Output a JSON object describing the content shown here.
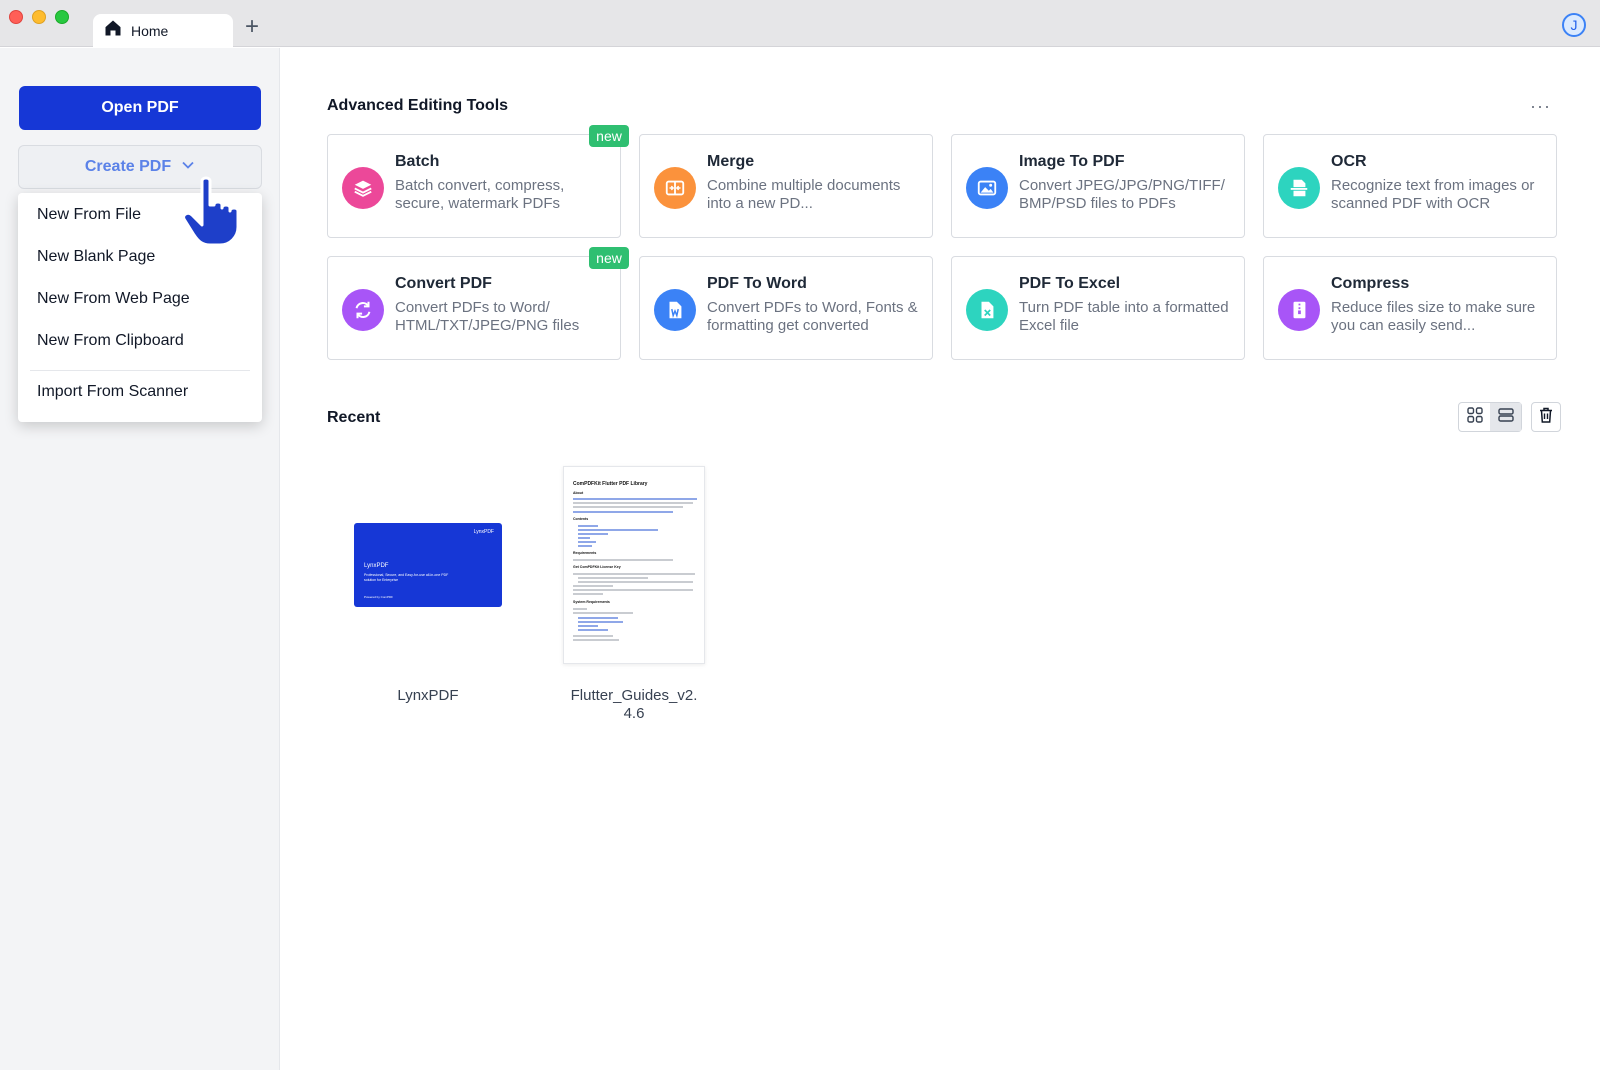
{
  "window": {
    "tab_label": "Home",
    "new_tab_symbol": "+",
    "avatar_initial": "J"
  },
  "sidebar": {
    "open_pdf_label": "Open PDF",
    "create_pdf_label": "Create PDF",
    "create_menu": {
      "items": [
        {
          "label": "New From File"
        },
        {
          "label": "New Blank Page"
        },
        {
          "label": "New From Web Page"
        },
        {
          "label": "New From Clipboard"
        },
        {
          "label": "Import From Scanner"
        }
      ]
    }
  },
  "tools": {
    "title": "Advanced Editing Tools",
    "more_symbol": "···",
    "badge_label": "new",
    "cards": [
      {
        "title": "Batch",
        "desc": "Batch convert, compress, secure, watermark PDFs",
        "icon": "layers-icon",
        "color": "#ec4899",
        "badge": true
      },
      {
        "title": "Merge",
        "desc": "Combine multiple documents into a new PD...",
        "icon": "merge-icon",
        "color": "#fb923c",
        "badge": false
      },
      {
        "title": "Image To PDF",
        "desc": "Convert JPEG/JPG/PNG/TIFF/ BMP/PSD files to PDFs",
        "icon": "image-icon",
        "color": "#3b82f6",
        "badge": false
      },
      {
        "title": "OCR",
        "desc": "Recognize text from images or scanned PDF with OCR",
        "icon": "scan-icon",
        "color": "#2dd4bf",
        "badge": false
      },
      {
        "title": "Convert PDF",
        "desc": "Convert PDFs to Word/ HTML/TXT/JPEG/PNG files",
        "icon": "convert-icon",
        "color": "#a855f7",
        "badge": true
      },
      {
        "title": "PDF To Word",
        "desc": "Convert PDFs to Word, Fonts & formatting get converted",
        "icon": "word-icon",
        "color": "#3b82f6",
        "badge": false
      },
      {
        "title": "PDF To Excel",
        "desc": "Turn PDF table into a formatted Excel file",
        "icon": "excel-icon",
        "color": "#2dd4bf",
        "badge": false
      },
      {
        "title": "Compress",
        "desc": "Reduce files size to make sure you can easily send...",
        "icon": "compress-icon",
        "color": "#a855f7",
        "badge": false
      }
    ]
  },
  "recent": {
    "title": "Recent",
    "files": [
      {
        "name": "LynxPDF",
        "thumb_texts": [
          "LynxPDF",
          "LynxPDF",
          "Professional, Secure, and Easy-for-use all-in-one PDF solution for Enterprise",
          "Powered by ComPDF"
        ]
      },
      {
        "name": "Flutter_Guides_v2.\n4.6",
        "thumb_texts": [
          "ComPDFKit Flutter PDF Library",
          "About",
          "Contents",
          "Requirements",
          "Get ComPDFKit License Key",
          "System Requirements"
        ]
      }
    ]
  },
  "colors": {
    "primary": "#1637d6",
    "create_text": "#5b82e8",
    "badge_green": "#2fbf71"
  }
}
